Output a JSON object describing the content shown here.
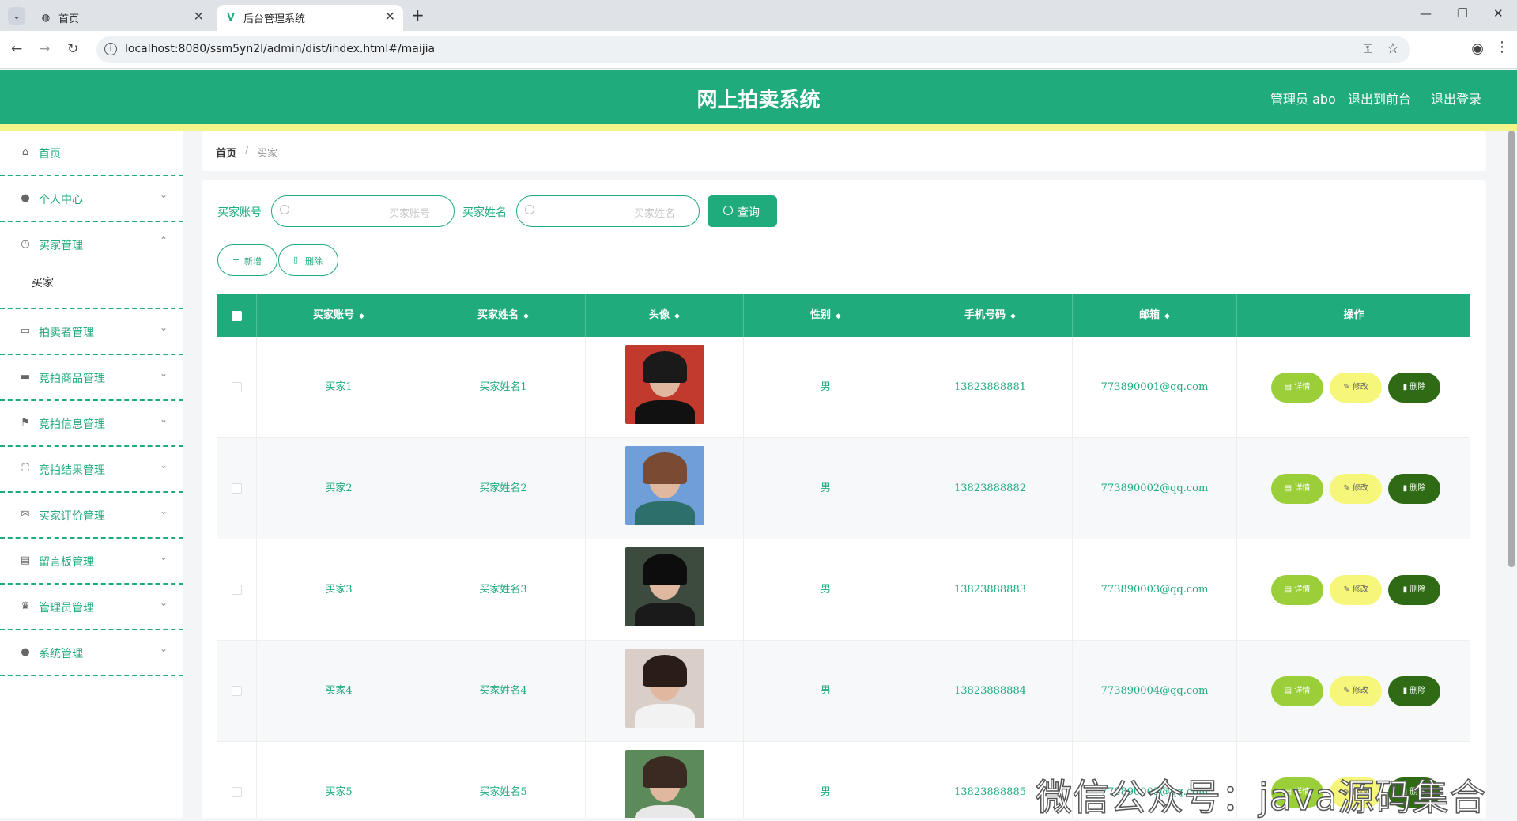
{
  "browser": {
    "tabs": [
      {
        "title": "首页",
        "active": false
      },
      {
        "title": "后台管理系统",
        "active": true
      }
    ],
    "url": "localhost:8080/ssm5yn2l/admin/dist/index.html#/maijia"
  },
  "header": {
    "title": "网上拍卖系统",
    "admin_label": "管理员 abo",
    "exit_front_label": "退出到前台",
    "logout_label": "退出登录"
  },
  "sidebar": {
    "items": [
      {
        "label": "首页",
        "icon": "home-icon",
        "arrow": ""
      },
      {
        "label": "个人中心",
        "icon": "user-icon",
        "arrow": "⌄"
      },
      {
        "label": "买家管理",
        "icon": "clock-icon",
        "arrow": "⌃"
      },
      {
        "label": "买家",
        "icon": "",
        "arrow": ""
      },
      {
        "label": "拍卖者管理",
        "icon": "chat-icon",
        "arrow": "⌄"
      },
      {
        "label": "竞拍商品管理",
        "icon": "briefcase-icon",
        "arrow": "⌄"
      },
      {
        "label": "竞拍信息管理",
        "icon": "flag-icon",
        "arrow": "⌄"
      },
      {
        "label": "竞拍结果管理",
        "icon": "frame-icon",
        "arrow": "⌄"
      },
      {
        "label": "买家评价管理",
        "icon": "mail-icon",
        "arrow": "⌄"
      },
      {
        "label": "留言板管理",
        "icon": "clipboard-icon",
        "arrow": "⌄"
      },
      {
        "label": "管理员管理",
        "icon": "cup-icon",
        "arrow": "⌄"
      },
      {
        "label": "系统管理",
        "icon": "globe-icon",
        "arrow": "⌄"
      }
    ]
  },
  "breadcrumb": {
    "home": "首页",
    "sep": "/",
    "current": "买家"
  },
  "filters": {
    "account_label": "买家账号",
    "account_placeholder": "买家账号",
    "name_label": "买家姓名",
    "name_placeholder": "买家姓名",
    "query_label": "查询"
  },
  "actions": {
    "add_label": "新增",
    "delete_label": "删除"
  },
  "table": {
    "columns": [
      "买家账号",
      "买家姓名",
      "头像",
      "性别",
      "手机号码",
      "邮箱",
      "操作"
    ],
    "rows": [
      {
        "account": "买家1",
        "name": "买家姓名1",
        "gender": "男",
        "phone": "13823888881",
        "email": "773890001@qq.com"
      },
      {
        "account": "买家2",
        "name": "买家姓名2",
        "gender": "男",
        "phone": "13823888882",
        "email": "773890002@qq.com"
      },
      {
        "account": "买家3",
        "name": "买家姓名3",
        "gender": "男",
        "phone": "13823888883",
        "email": "773890003@qq.com"
      },
      {
        "account": "买家4",
        "name": "买家姓名4",
        "gender": "男",
        "phone": "13823888884",
        "email": "773890004@qq.com"
      },
      {
        "account": "买家5",
        "name": "买家姓名5",
        "gender": "男",
        "phone": "13823888885",
        "email": "773890005@qq.com"
      }
    ],
    "row_buttons": {
      "detail": "详情",
      "edit": "修改",
      "delete": "删除"
    }
  },
  "watermark": "微信公众号：java源码集合",
  "colors": {
    "brand": "#1fab7b",
    "accent_yellow": "#f3f58b",
    "detail_btn": "#9bcf3a",
    "edit_btn": "#f6f77a",
    "delete_btn": "#2e6b14"
  }
}
